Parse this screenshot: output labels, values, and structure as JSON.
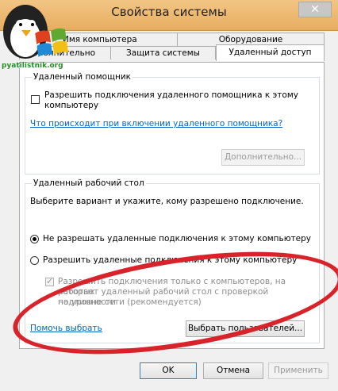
{
  "window": {
    "title": "Свойства системы",
    "close_label": "✕"
  },
  "logo": {
    "text": "pyatilistnik.org"
  },
  "tabs": {
    "row1": [
      "Имя компьютера",
      "Оборудование"
    ],
    "row2": [
      "Дополнительно",
      "Защита системы",
      "Удаленный доступ"
    ]
  },
  "remote_assistance": {
    "title": "Удаленный помощник",
    "checkbox_label_line1": "Разрешить подключения удаленного помощника к этому",
    "checkbox_label_line2": "компьютеру",
    "help_link": "Что происходит при включении удаленного помощника?",
    "advanced_button": "Дополнительно..."
  },
  "remote_desktop": {
    "title": "Удаленный рабочий стол",
    "instruction": "Выберите вариант и укажите, кому разрешено подключение.",
    "option_deny": "Не разрешать удаленные подключения к этому компьютеру",
    "option_allow": "Разрешить удаленные подключения к этому компьютеру",
    "nla_line1": "Разрешить подключения только с компьютеров, на которых",
    "nla_line2": "работает удаленный рабочий стол с проверкой подлинности",
    "nla_line3": "на уровне сети (рекомендуется)",
    "help_link": "Помочь выбрать",
    "select_users_button": "Выбрать пользователей..."
  },
  "footer": {
    "ok": "OK",
    "cancel": "Отмена",
    "apply": "Применить"
  },
  "colors": {
    "accent_link": "#0066cc",
    "highlight_circle": "#d9232a",
    "title_bar": "#e9b76f"
  }
}
